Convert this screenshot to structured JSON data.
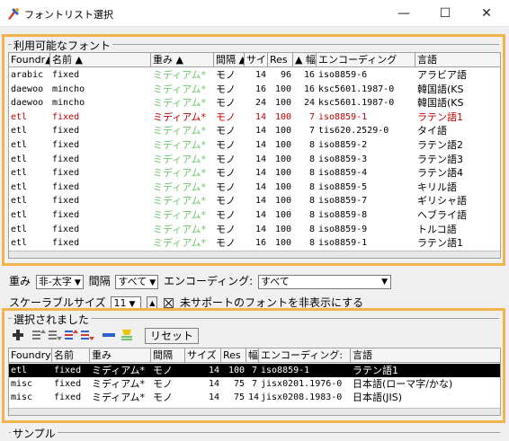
{
  "window": {
    "title": "フォントリスト選択",
    "minimize": "—",
    "maximize": "☐",
    "close": "✕"
  },
  "available": {
    "group_label": "利用可能なフォント",
    "columns": [
      "Foundr▲",
      "名前 ▲",
      "重み ▲",
      "間隔 ▲",
      "サイ",
      "Res",
      "▲ 幅",
      "エンコーディング",
      "言語"
    ],
    "rows": [
      {
        "foundry": "arabic",
        "name": "fixed",
        "weight": "ミディアム*",
        "spacing": "モノ",
        "size": "14",
        "res": "96",
        "width": "16",
        "encoding": "iso8859-6",
        "lang": "アラビア語",
        "style": "normal"
      },
      {
        "foundry": "daewoo",
        "name": "mincho",
        "weight": "ミディアム*",
        "spacing": "モノ",
        "size": "16",
        "res": "100",
        "width": "16",
        "encoding": "ksc5601.1987-0",
        "lang": "韓国語(KS",
        "style": "normal"
      },
      {
        "foundry": "daewoo",
        "name": "mincho",
        "weight": "ミディアム*",
        "spacing": "モノ",
        "size": "24",
        "res": "100",
        "width": "24",
        "encoding": "ksc5601.1987-0",
        "lang": "韓国語(KS",
        "style": "normal"
      },
      {
        "foundry": "etl",
        "name": "fixed",
        "weight": "ミディアム*",
        "spacing": "モノ",
        "size": "14",
        "res": "100",
        "width": "7",
        "encoding": "iso8859-1",
        "lang": "ラテン語1",
        "style": "red"
      },
      {
        "foundry": "etl",
        "name": "fixed",
        "weight": "ミディアム*",
        "spacing": "モノ",
        "size": "14",
        "res": "100",
        "width": "7",
        "encoding": "tis620.2529-0",
        "lang": "タイ語",
        "style": "normal"
      },
      {
        "foundry": "etl",
        "name": "fixed",
        "weight": "ミディアム*",
        "spacing": "モノ",
        "size": "14",
        "res": "100",
        "width": "8",
        "encoding": "iso8859-2",
        "lang": "ラテン語2",
        "style": "normal"
      },
      {
        "foundry": "etl",
        "name": "fixed",
        "weight": "ミディアム*",
        "spacing": "モノ",
        "size": "14",
        "res": "100",
        "width": "8",
        "encoding": "iso8859-3",
        "lang": "ラテン語3",
        "style": "normal"
      },
      {
        "foundry": "etl",
        "name": "fixed",
        "weight": "ミディアム*",
        "spacing": "モノ",
        "size": "14",
        "res": "100",
        "width": "8",
        "encoding": "iso8859-4",
        "lang": "ラテン語4",
        "style": "normal"
      },
      {
        "foundry": "etl",
        "name": "fixed",
        "weight": "ミディアム*",
        "spacing": "モノ",
        "size": "14",
        "res": "100",
        "width": "8",
        "encoding": "iso8859-5",
        "lang": "キリル語",
        "style": "normal"
      },
      {
        "foundry": "etl",
        "name": "fixed",
        "weight": "ミディアム*",
        "spacing": "モノ",
        "size": "14",
        "res": "100",
        "width": "8",
        "encoding": "iso8859-7",
        "lang": "ギリシャ語",
        "style": "normal"
      },
      {
        "foundry": "etl",
        "name": "fixed",
        "weight": "ミディアム*",
        "spacing": "モノ",
        "size": "14",
        "res": "100",
        "width": "8",
        "encoding": "iso8859-8",
        "lang": "ヘブライ語",
        "style": "normal"
      },
      {
        "foundry": "etl",
        "name": "fixed",
        "weight": "ミディアム*",
        "spacing": "モノ",
        "size": "14",
        "res": "100",
        "width": "8",
        "encoding": "iso8859-9",
        "lang": "トルコ語",
        "style": "normal"
      },
      {
        "foundry": "etl",
        "name": "fixed",
        "weight": "ミディアム*",
        "spacing": "モノ",
        "size": "16",
        "res": "100",
        "width": "8",
        "encoding": "iso8859-1",
        "lang": "ラテン語1",
        "style": "normal"
      }
    ]
  },
  "filters": {
    "weight_label": "重み",
    "weight_value": "非-太字",
    "spacing_label": "間隔",
    "spacing_value": "すべて",
    "encoding_label": "エンコーディング:",
    "encoding_value": "すべて",
    "scalable_label": "スケーラブルサイズ",
    "scalable_value": "11",
    "hide_unsupported_label": "未サポートのフォントを非表示にする",
    "hide_unsupported_checked": true
  },
  "selected": {
    "group_label": "選択されました",
    "reset_label": "リセット",
    "columns": [
      "Foundry",
      "名前",
      "重み",
      "間隔",
      "サイズ",
      "Res",
      "幅",
      "エンコーディング:",
      "言語"
    ],
    "rows": [
      {
        "foundry": "etl",
        "name": "fixed",
        "weight": "ミディアム*",
        "spacing": "モノ",
        "size": "14",
        "res": "100",
        "width": "7",
        "encoding": "iso8859-1",
        "lang": "ラテン語1",
        "style": "selected"
      },
      {
        "foundry": "misc",
        "name": "fixed",
        "weight": "ミディアム*",
        "spacing": "モノ",
        "size": "14",
        "res": "75",
        "width": "7",
        "encoding": "jisx0201.1976-0",
        "lang": "日本語(ローマ字/かな)",
        "style": "normal"
      },
      {
        "foundry": "misc",
        "name": "fixed",
        "weight": "ミディアム*",
        "spacing": "モノ",
        "size": "14",
        "res": "75",
        "width": "14",
        "encoding": "jisx0208.1983-0",
        "lang": "日本語(JIS)",
        "style": "normal"
      }
    ]
  },
  "sample": {
    "group_label": "サンプル"
  },
  "colors": {
    "highlight_border": "#f2b24c",
    "weight_text": "#6ec46e",
    "highlight_row": "#c00000",
    "selected_row_bg": "#000000"
  }
}
